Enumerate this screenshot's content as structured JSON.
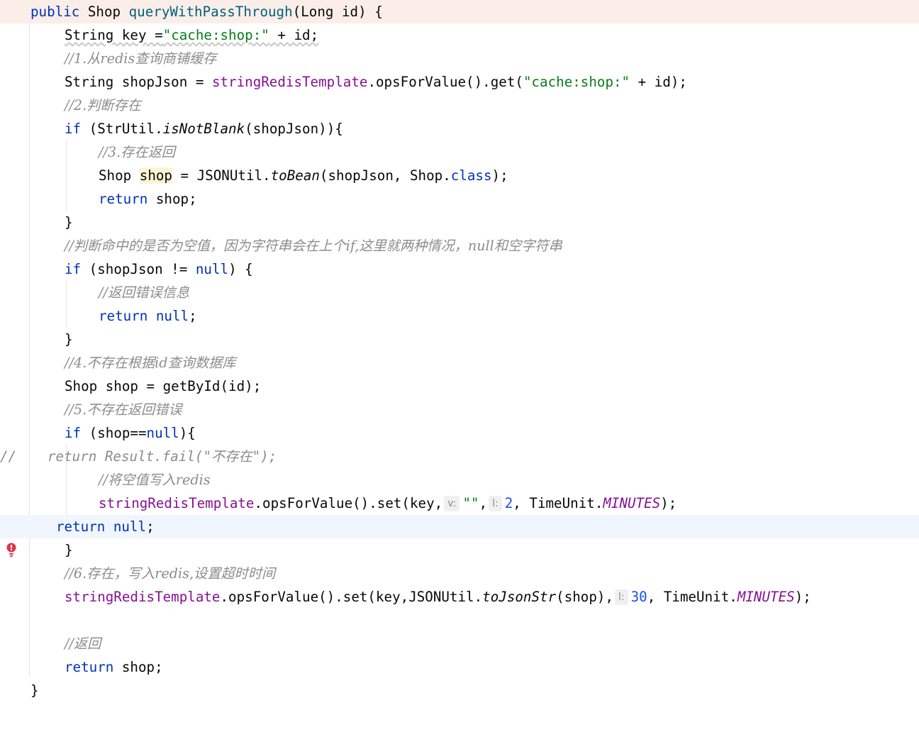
{
  "editor": {
    "lines": {
      "l1": {
        "kw": "public",
        "type": " Shop ",
        "method": "queryWithPassThrough",
        "rest": "(Long id) {"
      },
      "l2": {
        "a": "String ",
        "b": "key",
        "c": " =",
        "str": "\"cache:shop:\"",
        "d": " + id;"
      },
      "l3": {
        "comment": "//1.从redis查询商铺缓存"
      },
      "l4": {
        "a": "String shopJson = ",
        "fld": "stringRedisTemplate",
        "b": ".opsForValue().get(",
        "str": "\"cache:shop:\"",
        "c": " + id);"
      },
      "l5": {
        "comment": "//2.判断存在"
      },
      "l6": {
        "kw": "if",
        "a": " (StrUtil.",
        "it": "isNotBlank",
        "b": "(shopJson)){"
      },
      "l7": {
        "comment": "//3.存在返回"
      },
      "l8": {
        "a": "Shop ",
        "var": "shop",
        "b": " = JSONUtil.",
        "it": "toBean",
        "c": "(shopJson, Shop.",
        "kw": "class",
        "d": ");"
      },
      "l9": {
        "kw": "return",
        "a": " shop;"
      },
      "l10": {
        "a": "}"
      },
      "l11": {
        "comment": "//判断命中的是否为空值，因为字符串会在上个if,这里就两种情况，null和空字符串"
      },
      "l12": {
        "kw": "if",
        "a": " (shopJson != ",
        "kw2": "null",
        "b": ") {"
      },
      "l13": {
        "comment": "//返回错误信息"
      },
      "l14": {
        "kw": "return",
        "kw2": " null",
        "a": ";"
      },
      "l15": {
        "a": "}"
      },
      "l16": {
        "comment": "//4.不存在根据id查询数据库"
      },
      "l17": {
        "a": "Shop shop = getById(id);"
      },
      "l18": {
        "comment": "//5.不存在返回错误"
      },
      "l19": {
        "kw": "if",
        "a": " (shop==",
        "kw2": "null",
        "b": "){"
      },
      "l20": {
        "prefix": "//",
        "comment": "return Result.fail(\"不存在\");"
      },
      "l21": {
        "comment": "//将空值写入redis"
      },
      "l22": {
        "fld": "stringRedisTemplate",
        "a": ".opsForValue().set(key,",
        "hint1": "v:",
        "str": "\"\"",
        "b": ",",
        "hint2": "l:",
        "num": "2",
        "c": ", TimeUnit.",
        "const": "MINUTES",
        "d": ");"
      },
      "l23": {
        "kw": "return",
        "kw2": " null",
        "a": ";"
      },
      "l24": {
        "a": "}"
      },
      "l25": {
        "comment": "//6.存在，写入redis,设置超时时间"
      },
      "l26": {
        "fld": "stringRedisTemplate",
        "a": ".opsForValue().set(key,JSONUtil.",
        "it": "toJsonStr",
        "b": "(shop),",
        "hint": "l:",
        "num": "30",
        "c": ", TimeUnit.",
        "const": "MINUTES",
        "d": ");"
      },
      "l27": {
        "comment": "//返回"
      },
      "l28": {
        "kw": "return",
        "a": " shop;"
      },
      "l29": {
        "a": "}"
      }
    },
    "colors": {
      "keyword": "#0033b3",
      "string": "#067d17",
      "number": "#1750eb",
      "comment": "#8c8c8c",
      "field": "#871094",
      "method": "#00627a",
      "error": "#e0354a"
    },
    "icons": {
      "error_gutter": "error-bulb-icon"
    }
  }
}
